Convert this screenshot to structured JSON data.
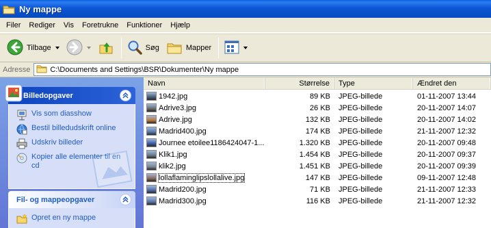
{
  "window": {
    "title": "Ny mappe"
  },
  "menu": [
    "Filer",
    "Rediger",
    "Vis",
    "Foretrukne",
    "Funktioner",
    "Hjælp"
  ],
  "toolbar": {
    "back_label": "Tilbage",
    "search_label": "Søg",
    "folders_label": "Mapper"
  },
  "address": {
    "label": "Adresse",
    "path": "C:\\Documents and Settings\\BSR\\Dokumenter\\Ny mappe"
  },
  "tasks": {
    "picture": {
      "title": "Billedopgaver",
      "items": [
        {
          "label": "Vis som diasshow",
          "icon": "slideshow-icon"
        },
        {
          "label": "Bestil billedudskrift online",
          "icon": "order-prints-icon"
        },
        {
          "label": "Udskriv billeder",
          "icon": "printer-icon"
        },
        {
          "label": "Kopier alle elementer til en cd",
          "icon": "copy-to-cd-icon"
        }
      ]
    },
    "file": {
      "title": "Fil- og mappeopgaver",
      "items": [
        {
          "label": "Opret en ny mappe",
          "icon": "new-folder-icon"
        }
      ]
    }
  },
  "columns": {
    "name": "Navn",
    "size": "Størrelse",
    "type": "Type",
    "date": "Ændret den"
  },
  "files": [
    {
      "name": "1942.jpg",
      "size": "89 KB",
      "type": "JPEG-billede",
      "date": "01-11-2007 13:44",
      "thumb": "#4a5f7a"
    },
    {
      "name": "Adrive3.jpg",
      "size": "26 KB",
      "type": "JPEG-billede",
      "date": "20-11-2007 14:07",
      "thumb": "#6b6b6b"
    },
    {
      "name": "Adrive.jpg",
      "size": "132 KB",
      "type": "JPEG-billede",
      "date": "20-11-2007 14:02",
      "thumb": "#c07a3a"
    },
    {
      "name": "Madrid400.jpg",
      "size": "174 KB",
      "type": "JPEG-billede",
      "date": "21-11-2007 12:32",
      "thumb": "#5a7ab0"
    },
    {
      "name": "Journee etoilee1186424047-1...",
      "size": "1.320 KB",
      "type": "JPEG-billede",
      "date": "20-11-2007 09:48",
      "thumb": "#3b5aa8"
    },
    {
      "name": "Klik1.jpg",
      "size": "1.454 KB",
      "type": "JPEG-billede",
      "date": "20-11-2007 09:37",
      "thumb": "#6d7b8a"
    },
    {
      "name": "klik2.jpg",
      "size": "1.451 KB",
      "type": "JPEG-billede",
      "date": "20-11-2007 09:39",
      "thumb": "#7b8894"
    },
    {
      "name": "lollaflaminglipslollalive.jpg",
      "size": "147 KB",
      "type": "JPEG-billede",
      "date": "09-11-2007 12:48",
      "thumb": "#8a6a5a"
    },
    {
      "name": "Madrid200.jpg",
      "size": "71 KB",
      "type": "JPEG-billede",
      "date": "21-11-2007 12:33",
      "thumb": "#4f6ea8"
    },
    {
      "name": "Madrid300.jpg",
      "size": "116 KB",
      "type": "JPEG-billede",
      "date": "21-11-2007 12:32",
      "thumb": "#5b78aa"
    }
  ],
  "focused_row": 7,
  "colors": {
    "titlebar": "#0a4bbd",
    "taskpane": "#6375d6",
    "link": "#215dc6",
    "chrome": "#ece9d8"
  }
}
